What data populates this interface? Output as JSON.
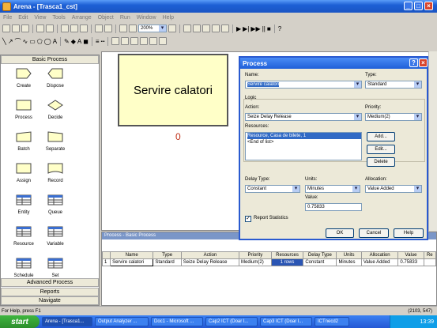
{
  "window": {
    "title": "Arena - [Trasca1_cst]"
  },
  "menu": [
    "File",
    "Edit",
    "View",
    "Tools",
    "Arrange",
    "Object",
    "Run",
    "Window",
    "Help"
  ],
  "toolbar": {
    "zoom": "200%"
  },
  "panel": {
    "title": "Basic Process",
    "modules": [
      {
        "name": "create-module",
        "label": "Create",
        "shape": "pentagon"
      },
      {
        "name": "dispose-module",
        "label": "Dispose",
        "shape": "pentagon-left"
      },
      {
        "name": "process-module",
        "label": "Process",
        "shape": "rect"
      },
      {
        "name": "decide-module",
        "label": "Decide",
        "shape": "diamond"
      },
      {
        "name": "batch-module",
        "label": "Batch",
        "shape": "batch"
      },
      {
        "name": "separate-module",
        "label": "Separate",
        "shape": "separate"
      },
      {
        "name": "assign-module",
        "label": "Assign",
        "shape": "rect"
      },
      {
        "name": "record-module",
        "label": "Record",
        "shape": "record"
      },
      {
        "name": "entity-module",
        "label": "Entity",
        "shape": "grid"
      },
      {
        "name": "queue-module",
        "label": "Queue",
        "shape": "grid"
      },
      {
        "name": "resource-module",
        "label": "Resource",
        "shape": "grid"
      },
      {
        "name": "variable-module",
        "label": "Variable",
        "shape": "grid"
      },
      {
        "name": "schedule-module",
        "label": "Schedule",
        "shape": "grid"
      },
      {
        "name": "set-module",
        "label": "Set",
        "shape": "grid"
      }
    ],
    "sections": [
      "Advanced Process",
      "Reports",
      "Navigate"
    ]
  },
  "canvas": {
    "module_label": "Servire calatori",
    "counter": "0"
  },
  "dialog": {
    "title": "Process",
    "name_label": "Name:",
    "name_value": "Servire calatori",
    "type_label": "Type:",
    "type_value": "Standard",
    "logic_label": "Logic",
    "action_label": "Action:",
    "action_value": "Seize Delay Release",
    "priority_label": "Priority:",
    "priority_value": "Medium(2)",
    "resources_label": "Resources:",
    "resources_items": [
      "Resource, Casa de bilete, 1",
      "<End of list>"
    ],
    "add_button": "Add...",
    "edit_button": "Edit...",
    "delete_button": "Delete",
    "delay_type_label": "Delay Type:",
    "delay_type_value": "Constant",
    "units_label": "Units:",
    "units_value": "Minutes",
    "allocation_label": "Allocation:",
    "allocation_value": "Value Added",
    "value_label": "Value:",
    "value_value": "0.75833",
    "report_stats_label": "Report Statistics",
    "ok_button": "OK",
    "cancel_button": "Cancel",
    "help_button": "Help"
  },
  "spreadsheet": {
    "title": "Process - Basic Process",
    "columns": [
      "",
      "Name",
      "Type",
      "Action",
      "Priority",
      "Resources",
      "Delay Type",
      "Units",
      "Allocation",
      "Value",
      "Re"
    ],
    "row": [
      "1",
      "Servire calatori",
      "Standard",
      "Seize Delay Release",
      "Medium(2)",
      "1 rows",
      "Constant",
      "Minutes",
      "Value Added",
      "0.75833",
      ""
    ]
  },
  "status": {
    "left": "For Help, press F1",
    "coords": "(2103, 547)"
  },
  "taskbar": {
    "start": "start",
    "items": [
      "Arena - [Trasca1...",
      "Output Analyzer ...",
      "Doc1 - Microsoft ...",
      "Cap2 ICT (Doar l...",
      "Cap3 ICT (Doar l...",
      "ICTnecd2"
    ],
    "time": "13:39"
  }
}
